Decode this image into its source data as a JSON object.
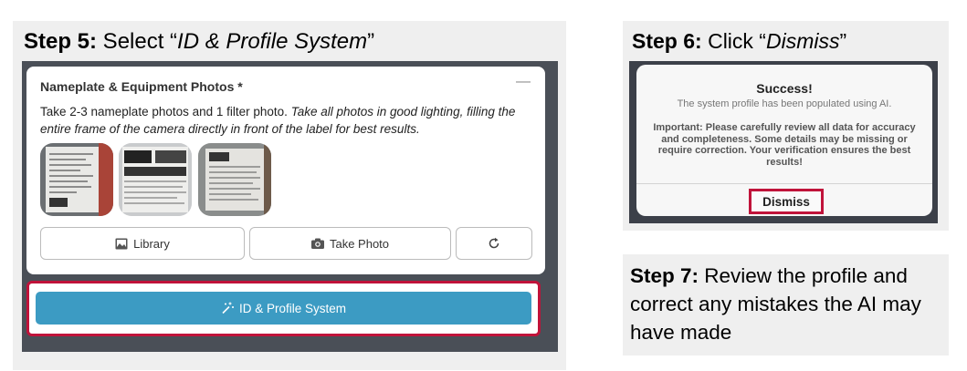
{
  "step5": {
    "label": "Step 5:",
    "prefix": " Select “",
    "emph": "ID & Profile System",
    "suffix": "”",
    "card": {
      "title": "Nameplate & Equipment Photos *",
      "collapse": "—",
      "desc_plain": "Take 2-3 nameplate photos and 1 filter photo. ",
      "desc_italic": "Take all photos in good lighting, filling the entire frame of the camera directly in front of the label for best results."
    },
    "buttons": {
      "library": "Library",
      "take_photo": "Take Photo"
    },
    "id_button": "ID & Profile System"
  },
  "step6": {
    "label": "Step 6:",
    "prefix": " Click “",
    "emph": "Dismiss",
    "suffix": "”",
    "dialog": {
      "title": "Success!",
      "message": "The system profile has been populated using AI.",
      "important": "Important: Please carefully review all data for accuracy and completeness. Some details may be missing or require correction. Your verification ensures the best results!",
      "dismiss": "Dismiss"
    }
  },
  "step7": {
    "label": "Step 7:",
    "text": " Review the profile and correct any mistakes the AI may have made"
  },
  "colors": {
    "highlight": "#c0133a",
    "primary_button": "#3c9bc3",
    "panel_bg": "#efefef"
  }
}
